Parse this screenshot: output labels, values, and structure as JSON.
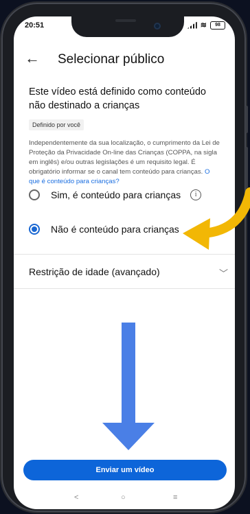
{
  "status_bar": {
    "time": "20:51",
    "battery": "98"
  },
  "header": {
    "back_icon": "←",
    "title": "Selecionar público"
  },
  "content": {
    "heading": "Este vídeo está definido como conteúdo não destinado a crianças",
    "badge": "Definido por você",
    "description": "Independentemente da sua localização, o cumprimento da Lei de Proteção da Privacidade On-line das Crianças (COPPA, na sigla em inglês) e/ou outras legislações é um requisito legal. É obrigatório informar se o canal tem conteúdo para crianças.",
    "description_link": "O que é conteúdo para crianças?"
  },
  "options": {
    "yes_label": "Sim, é conteúdo para crianças",
    "no_label": "Não é conteúdo para crianças",
    "selected": "no"
  },
  "restriction": {
    "label": "Restrição de idade (avançado)"
  },
  "actions": {
    "send_label": "Enviar um vídeo"
  },
  "nav": {
    "back": "<",
    "home": "○",
    "recents": "≡"
  },
  "colors": {
    "accent": "#0d65d9",
    "arrow_yellow": "#f2b705",
    "arrow_blue": "#4a7fe6"
  }
}
